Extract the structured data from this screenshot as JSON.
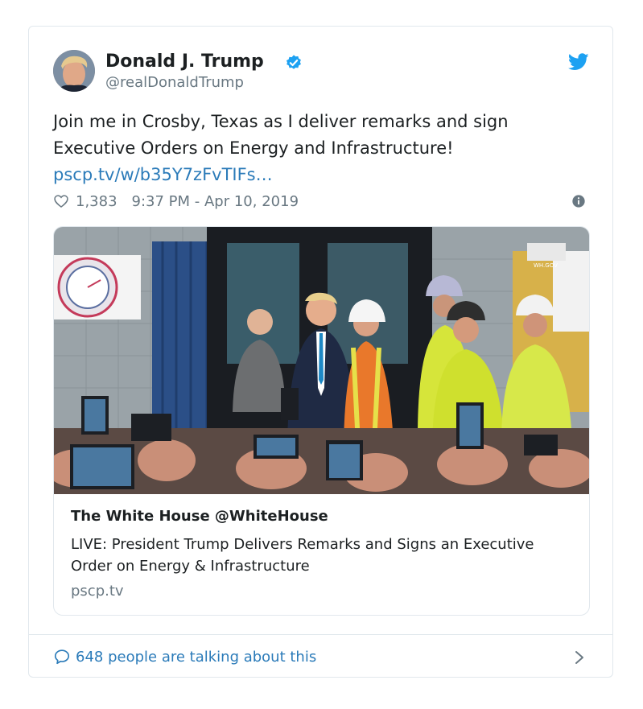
{
  "tweet": {
    "author_name": "Donald J. Trump",
    "handle": "@realDonaldTrump",
    "text_line1": "Join me in Crosby, Texas as I deliver remarks and sign",
    "text_line2": "Executive Orders on Energy and Infrastructure!",
    "link": "pscp.tv/w/b35Y7zFvTIFs…",
    "likes": "1,383",
    "timestamp": "9:37 PM - Apr 10, 2019"
  },
  "card": {
    "title": "The White House @WhiteHouse",
    "description": "LIVE: President Trump Delivers Remarks and Signs an Executive Order on Energy & Infrastructure",
    "domain": "pscp.tv",
    "photo_watermark": "WH.GOV"
  },
  "footer": {
    "talking": "648 people are talking about this"
  },
  "colors": {
    "link": "#2b7bb9",
    "muted": "#697882",
    "verified": "#1da1f2",
    "border": "#e1e8ed"
  },
  "icons": [
    "verified-badge-icon",
    "twitter-bird-icon",
    "heart-icon",
    "info-icon",
    "comment-bubble-icon",
    "chevron-right-icon"
  ]
}
